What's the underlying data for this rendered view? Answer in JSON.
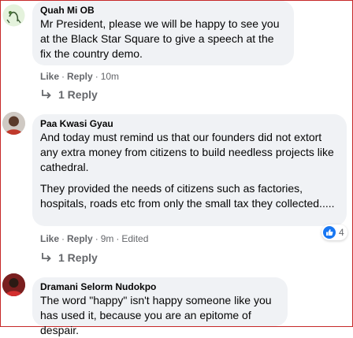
{
  "comments": [
    {
      "author": "Quah Mi OB",
      "text": [
        "Mr President, please we will be happy to see you at the Black Star Square to give a speech at the fix the country demo."
      ],
      "actions": {
        "like": "Like",
        "reply": "Reply",
        "time": "10m"
      },
      "replies_label": "1 Reply"
    },
    {
      "author": "Paa Kwasi Gyau",
      "text": [
        "And today must remind us that our founders did not extort any extra money from citizens to build needless projects like cathedral.",
        "They provided the needs of citizens such as factories, hospitals, roads etc from only the small tax they collected....."
      ],
      "actions": {
        "like": "Like",
        "reply": "Reply",
        "time": "9m",
        "edited": "Edited"
      },
      "reaction_count": "4",
      "replies_label": "1 Reply"
    },
    {
      "author": "Dramani Selorm Nudokpo",
      "text": [
        "The word \"happy\" isn't happy someone like you has used it, because you are an epitome of despair."
      ]
    }
  ],
  "colors": {
    "bubble": "#f0f2f5",
    "meta_text": "#65676b",
    "like_blue": "#1877f2",
    "frame_border": "#c62828"
  },
  "icons": [
    "default-avatar-icon",
    "reply-arrow-icon",
    "like-thumb-icon"
  ]
}
